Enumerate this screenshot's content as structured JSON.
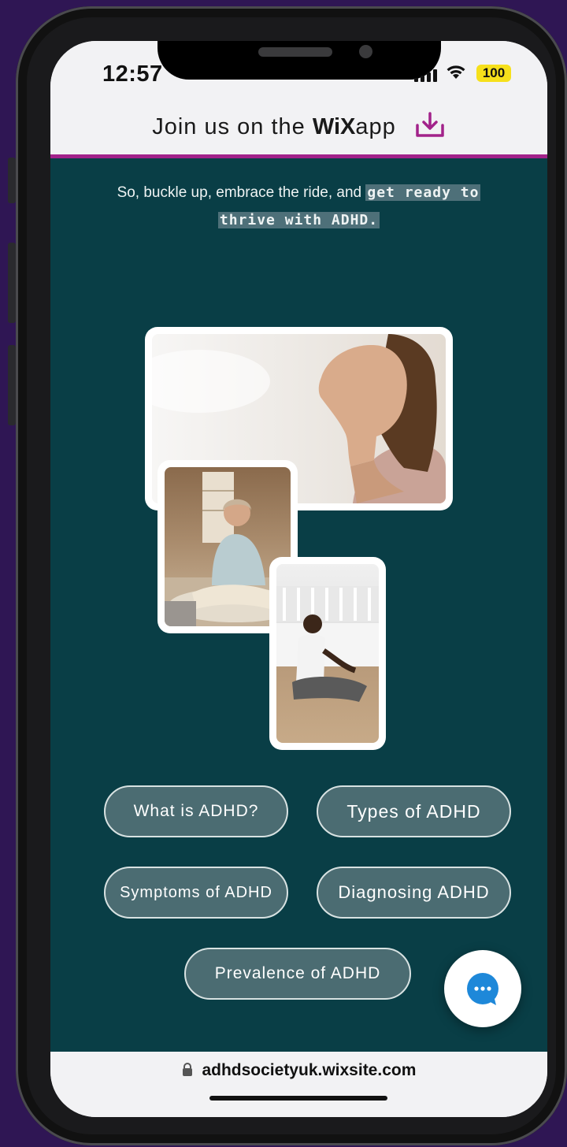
{
  "status_bar": {
    "time": "12:57",
    "battery": "100"
  },
  "banner": {
    "prefix": "Join us on the",
    "brand_mark": "WiX",
    "brand_suffix": "app",
    "icon": "download-icon",
    "accent_color": "#a2228a"
  },
  "intro": {
    "plain": "So, buckle up, embrace the ride, and",
    "highlight_1": "get ready to",
    "highlight_2": "thrive with ADHD."
  },
  "images": [
    {
      "name": "woman-breathing-photo"
    },
    {
      "name": "woman-meditating-photo"
    },
    {
      "name": "man-meditating-photo"
    }
  ],
  "buttons": {
    "what_is": "What is ADHD?",
    "types": "Types of ADHD",
    "symptoms": "Symptoms of ADHD",
    "diagnosing": "Diagnosing ADHD",
    "prevalence": "Prevalence of ADHD"
  },
  "chat": {
    "icon": "chat-bubble-icon",
    "color": "#1e88d9"
  },
  "url_bar": {
    "lock_icon": "lock-icon",
    "url": "adhdsocietyuk.wixsite.com"
  },
  "colors": {
    "page_bg": "#093e46",
    "button_bg": "#4b6c72",
    "backdrop": "#2f1654"
  }
}
